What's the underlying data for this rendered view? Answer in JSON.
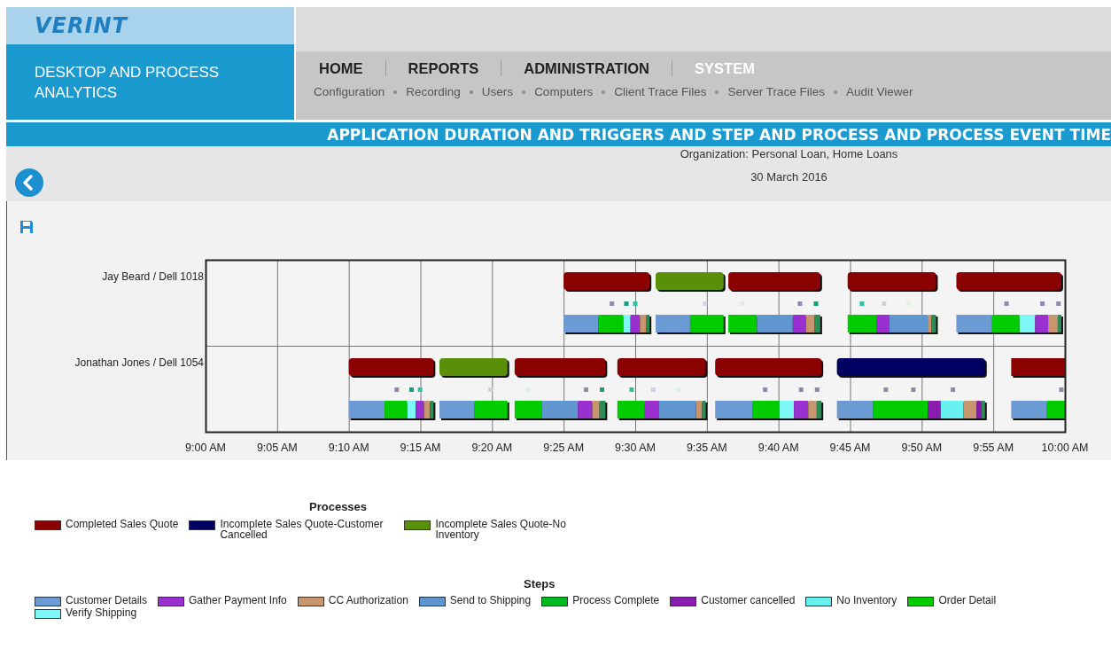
{
  "header": {
    "logo": "VERINT",
    "product": "DESKTOP AND PROCESS ANALYTICS",
    "nav": [
      {
        "label": "HOME",
        "selected": false
      },
      {
        "label": "REPORTS",
        "selected": false
      },
      {
        "label": "ADMINISTRATION",
        "selected": false
      },
      {
        "label": "SYSTEM",
        "selected": true
      }
    ],
    "subnav": [
      "Configuration",
      "Recording",
      "Users",
      "Computers",
      "Client Trace Files",
      "Server Trace Files",
      "Audit Viewer"
    ]
  },
  "report": {
    "title": "APPLICATION DURATION AND TRIGGERS AND STEP AND PROCESS AND PROCESS EVENT TIME",
    "organization": "Organization: Personal Loan, Home Loans",
    "date": "30 March 2016"
  },
  "timeline": {
    "rows": [
      "Jay Beard / Dell 1018",
      "Jonathan Jones / Dell 1054"
    ],
    "ticks": [
      "9:00 AM",
      "9:05 AM",
      "9:10 AM",
      "9:15 AM",
      "9:20 AM",
      "9:25 AM",
      "9:30 AM",
      "9:35 AM",
      "9:40 AM",
      "9:45 AM",
      "9:50 AM",
      "9:55 AM",
      "10:00 AM"
    ]
  },
  "legend": {
    "processes": {
      "title": "Processes",
      "items": [
        {
          "label": "Completed Sales Quote",
          "color": "#8b0000"
        },
        {
          "label": "Incomplete Sales Quote-Customer Cancelled",
          "color": "#000060"
        },
        {
          "label": "Incomplete Sales Quote-No Inventory",
          "color": "#5a8f0a"
        }
      ]
    },
    "steps": {
      "title": "Steps",
      "items": [
        {
          "label": "Customer Details",
          "color": "#6b9bd2"
        },
        {
          "label": "Gather Payment Info",
          "color": "#9b30d0"
        },
        {
          "label": "CC Authorization",
          "color": "#c8966e"
        },
        {
          "label": "Send to Shipping",
          "color": "#6096d0"
        },
        {
          "label": "Process Complete",
          "color": "#00b820"
        },
        {
          "label": "Customer cancelled",
          "color": "#8a1cb0"
        },
        {
          "label": "No Inventory",
          "color": "#66f0f0"
        },
        {
          "label": "Order Detail",
          "color": "#00cc00"
        },
        {
          "label": "Verify Shipping",
          "color": "#7ef7f7"
        }
      ]
    }
  }
}
